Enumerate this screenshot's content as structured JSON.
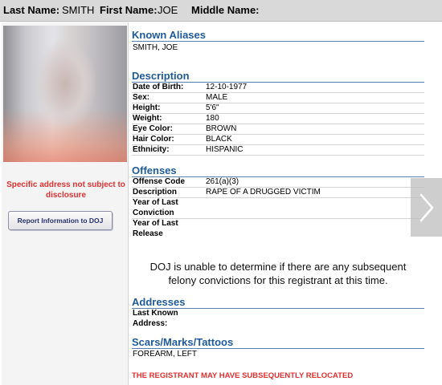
{
  "header": {
    "last_name_label": "Last Name:",
    "last_name": "SMITH",
    "first_name_label": "First Name:",
    "first_name": "JOE",
    "middle_name_label": "Middle Name:",
    "middle_name": ""
  },
  "sidebar": {
    "address_note": "Specific address not subject to disclosure",
    "report_button": "Report Information to DOJ"
  },
  "aliases": {
    "title": "Known Aliases",
    "value": "SMITH, JOE"
  },
  "description": {
    "title": "Description",
    "rows": [
      {
        "label": "Date of Birth:",
        "value": "12-10-1977"
      },
      {
        "label": "Sex:",
        "value": "MALE"
      },
      {
        "label": "Height:",
        "value": "5'6\""
      },
      {
        "label": "Weight:",
        "value": "180"
      },
      {
        "label": "Eye Color:",
        "value": "BROWN"
      },
      {
        "label": "Hair Color:",
        "value": "BLACK"
      },
      {
        "label": "Ethnicity:",
        "value": "HISPANIC"
      }
    ]
  },
  "offenses": {
    "title": "Offenses",
    "offense_code_label": "Offense Code",
    "offense_code": "261(a)(3)",
    "description_label": "Description",
    "description": "RAPE OF A DRUGGED VICTIM",
    "last_conviction_label_1": "Year of Last",
    "last_conviction_label_2": "Conviction",
    "last_release_label_1": "Year of Last",
    "last_release_label_2": "Release"
  },
  "notice": {
    "line1": "DOJ is unable to determine if there are any subsequent",
    "line2": "felony convictions for this registrant at this time."
  },
  "addresses": {
    "title": "Addresses",
    "label_1": "Last Known",
    "label_2": "Address:"
  },
  "scars": {
    "title": "Scars/Marks/Tattoos",
    "value": "FOREARM, LEFT"
  },
  "footer": {
    "relocated": "THE REGISTRANT MAY HAVE SUBSEQUENTLY RELOCATED"
  },
  "icons": {
    "next": "chevron-right-icon"
  },
  "colors": {
    "section_title": "#1f5a9a",
    "alert_red": "#e03030"
  }
}
